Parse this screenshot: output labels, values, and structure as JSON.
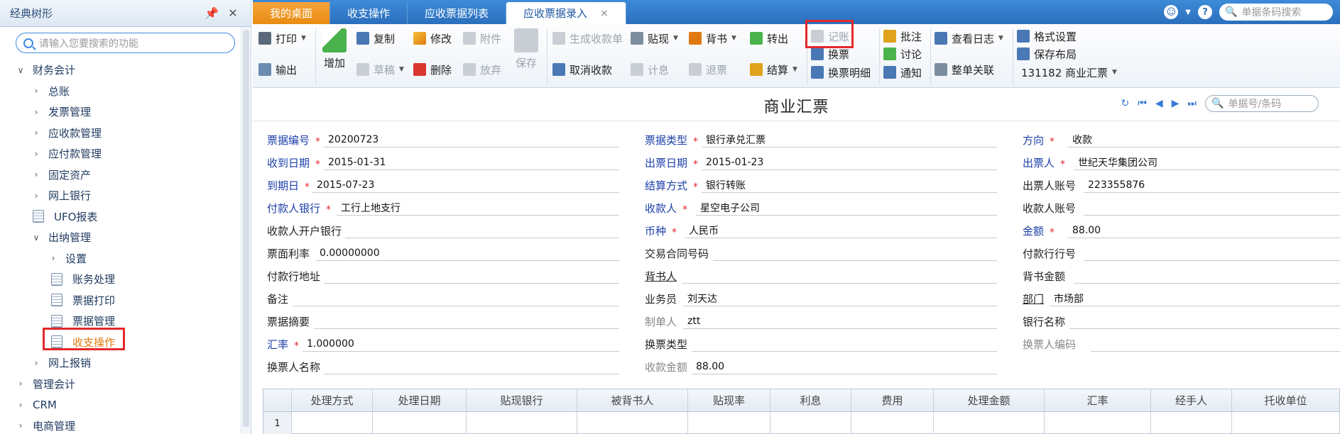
{
  "sidebar": {
    "title": "经典树形",
    "search_placeholder": "请输入您要搜索的功能",
    "items": [
      {
        "label": "财务会计",
        "arrow": "∨"
      },
      {
        "label": "总账",
        "arrow": "›"
      },
      {
        "label": "发票管理",
        "arrow": "›"
      },
      {
        "label": "应收款管理",
        "arrow": "›"
      },
      {
        "label": "应付款管理",
        "arrow": "›"
      },
      {
        "label": "固定资产",
        "arrow": "›"
      },
      {
        "label": "网上银行",
        "arrow": "›"
      },
      {
        "label": "UFO报表",
        "arrow": ""
      },
      {
        "label": "出纳管理",
        "arrow": "∨"
      },
      {
        "label": "设置",
        "arrow": "›"
      },
      {
        "label": "账务处理",
        "arrow": ""
      },
      {
        "label": "票据打印",
        "arrow": ""
      },
      {
        "label": "票据管理",
        "arrow": ""
      },
      {
        "label": "收支操作",
        "arrow": ""
      },
      {
        "label": "网上报销",
        "arrow": "›"
      },
      {
        "label": "管理会计",
        "arrow": "›"
      },
      {
        "label": "CRM",
        "arrow": "›"
      },
      {
        "label": "电商管理",
        "arrow": "›"
      }
    ]
  },
  "tabs": {
    "home": "我的桌面",
    "t1": "收支操作",
    "t2": "应收票据列表",
    "t3": "应收票据录入",
    "close": "×",
    "search_placeholder": "单据条码搜索"
  },
  "toolbar": {
    "print": "打印",
    "output": "输出",
    "add": "增加",
    "copy": "复制",
    "draft": "草稿",
    "modify": "修改",
    "delete": "删除",
    "attach": "附件",
    "discard": "放弃",
    "save": "保存",
    "gen_receipt": "生成收款单",
    "cancel_receipt": "取消收款",
    "discount": "贴现",
    "interest": "计息",
    "endorse": "背书",
    "refund": "退票",
    "transfer": "转出",
    "settle": "结算",
    "post": "记账",
    "exchange": "换票",
    "exchange_detail": "换票明细",
    "annotate": "批注",
    "discuss": "讨论",
    "notify": "通知",
    "view_log": "查看日志",
    "link_all": "整单关联",
    "format": "格式设置",
    "save_layout": "保存布局",
    "template": "131182 商业汇票"
  },
  "form": {
    "title": "商业汇票",
    "nav_placeholder": "单据号/条码",
    "f": {
      "no_l": "票据编号",
      "no_v": "20200723",
      "type_l": "票据类型",
      "type_v": "银行承兑汇票",
      "dir_l": "方向",
      "dir_v": "收款",
      "recv_date_l": "收到日期",
      "recv_date_v": "2015-01-31",
      "issue_date_l": "出票日期",
      "issue_date_v": "2015-01-23",
      "drawer_l": "出票人",
      "drawer_v": "世纪天华集团公司",
      "due_l": "到期日",
      "due_v": "2015-07-23",
      "settle_l": "结算方式",
      "settle_v": "银行转账",
      "drawer_acc_l": "出票人账号",
      "drawer_acc_v": "223355876",
      "payer_bank_l": "付款人银行",
      "payer_bank_v": "工行上地支行",
      "payee_l": "收款人",
      "payee_v": "星空电子公司",
      "payee_acc_l": "收款人账号",
      "payee_acc_v": "",
      "payee_bank_l": "收款人开户银行",
      "payee_bank_v": "",
      "currency_l": "币种",
      "currency_v": "人民币",
      "amount_l": "金额",
      "amount_v": "88.00",
      "rate_l": "票面利率",
      "rate_v": "0.00000000",
      "contract_l": "交易合同号码",
      "contract_v": "",
      "payer_code_l": "付款行行号",
      "payer_code_v": "",
      "payer_addr_l": "付款行地址",
      "payer_addr_v": "",
      "endorser_l": "背书人",
      "endorser_v": "",
      "endorse_amt_l": "背书金额",
      "endorse_amt_v": "",
      "note_l": "备注",
      "note_v": "",
      "clerk_l": "业务员",
      "clerk_v": "刘天达",
      "dept_l": "部门",
      "dept_v": "市场部",
      "summary_l": "票据摘要",
      "summary_v": "",
      "maker_l": "制单人",
      "maker_v": "ztt",
      "bank_name_l": "银行名称",
      "bank_name_v": "",
      "fx_l": "汇率",
      "fx_v": "1.000000",
      "ex_type_l": "换票类型",
      "ex_type_v": "",
      "ex_code_l": "换票人编码",
      "ex_code_v": "",
      "ex_name_l": "换票人名称",
      "ex_name_v": "",
      "recv_amt_l": "收款金额",
      "recv_amt_v": "88.00"
    }
  },
  "grid": {
    "columns": [
      "处理方式",
      "处理日期",
      "贴现银行",
      "被背书人",
      "贴现率",
      "利息",
      "费用",
      "处理金额",
      "汇率",
      "经手人",
      "托收单位"
    ],
    "row1": "1"
  }
}
